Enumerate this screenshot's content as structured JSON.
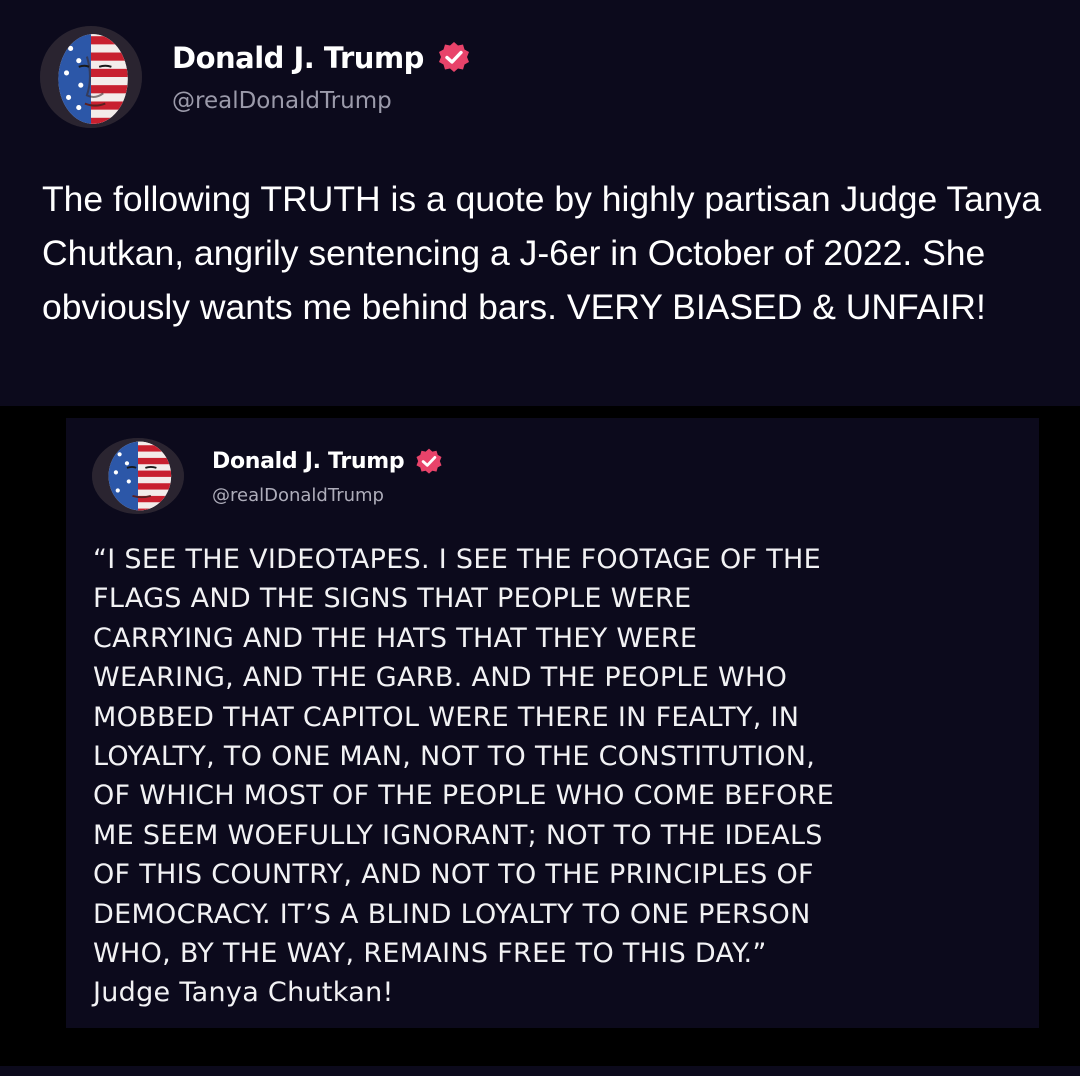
{
  "post": {
    "author": {
      "display_name": "Donald J. Trump",
      "handle": "@realDonaldTrump",
      "avatar_icon": "flag-portrait-avatar",
      "verified_icon": "verified-badge-icon"
    },
    "text": "The following TRUTH is a quote by highly partisan Judge Tanya Chutkan, angrily sentencing a J-6er in October of 2022. She obviously wants me behind bars. VERY BIASED & UNFAIR!"
  },
  "quoted_image": {
    "author": {
      "display_name": "Donald J. Trump",
      "handle": "@realDonaldTrump",
      "avatar_icon": "flag-portrait-avatar",
      "verified_icon": "verified-badge-icon"
    },
    "text": "“I SEE THE VIDEOTAPES. I SEE THE FOOTAGE OF THE\nFLAGS AND THE SIGNS THAT PEOPLE WERE\nCARRYING AND THE HATS THAT THEY WERE\nWEARING, AND THE GARB. AND THE PEOPLE WHO\nMOBBED THAT CAPITOL WERE THERE IN FEALTY, IN\nLOYALTY, TO ONE MAN, NOT TO THE CONSTITUTION,\nOF WHICH MOST OF THE PEOPLE WHO COME BEFORE\nME SEEM WOEFULLY IGNORANT; NOT TO THE IDEALS\nOF THIS COUNTRY, AND NOT TO THE PRINCIPLES OF\nDEMOCRACY. IT’S A BLIND LOYALTY TO ONE PERSON\nWHO, BY THE WAY, REMAINS FREE TO THIS DAY.”\nJudge Tanya Chutkan!"
  },
  "colors": {
    "background": "#0c0a1c",
    "media_background": "#000000",
    "text_primary": "#ffffff",
    "text_secondary": "#9b9aaa",
    "verified_badge": "#e8436a"
  }
}
